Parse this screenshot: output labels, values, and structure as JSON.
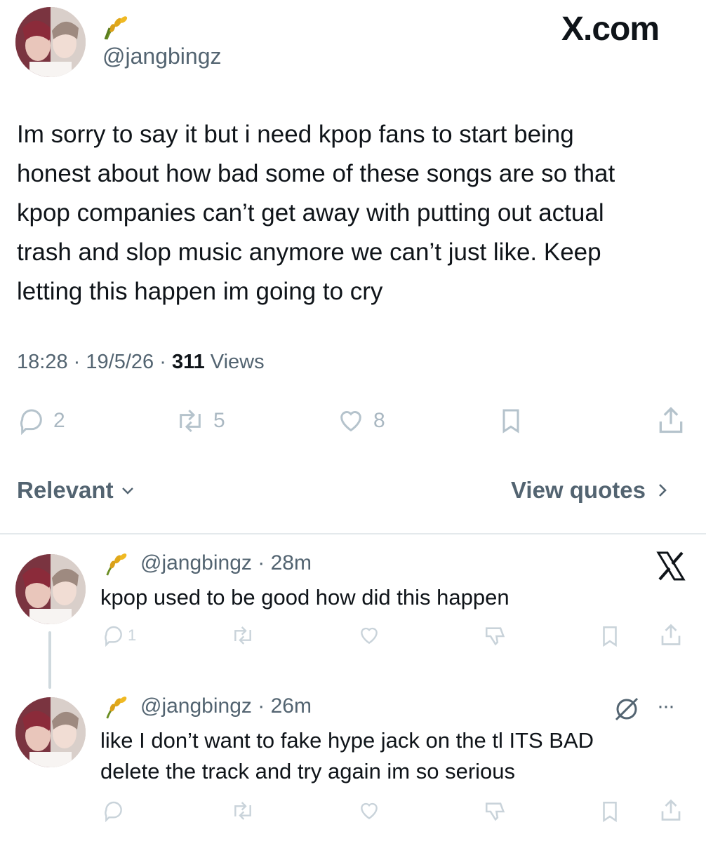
{
  "header": {
    "handle": "@jangbingz",
    "brand": "X.com",
    "avatar_icon": "profile-photo",
    "badge_icon": "wheat-emoji-icon"
  },
  "tweet": {
    "text": "Im sorry to say it but i need kpop fans to start being honest about how bad some of these songs are so that kpop companies can’t get away with putting out  actual trash and slop music anymore we can’t just like. Keep letting this happen im going to cry",
    "lines": [
      "Im sorry to say it but i need kpop fans to start being",
      "honest about how bad some of these songs are so that",
      "kpop companies can’t get away with putting out  actual",
      "trash and slop music anymore we can’t just like. Keep",
      "letting this happen im going to cry"
    ],
    "time": "18:28",
    "date": "19/5/26",
    "views_count": "311",
    "views_label": "Views",
    "sep": "·",
    "replies": "2",
    "reposts": "5",
    "likes": "8"
  },
  "sort": {
    "label": "Relevant",
    "view_quotes": "View quotes"
  },
  "replies": [
    {
      "handle": "@jangbingz",
      "time": "28m",
      "text": "kpop used to be good how did this happen",
      "reply_count": "1"
    },
    {
      "handle": "@jangbingz",
      "time": "26m",
      "text_lines": [
        "like I don’t want to fake hype jack on the tl ITS BAD",
        "delete the track  and try again im so serious"
      ],
      "more": "···"
    }
  ],
  "colors": {
    "text": "#0f1419",
    "secondary": "#536471",
    "icon_light": "#c9d3da",
    "divider": "#eff3f4"
  }
}
